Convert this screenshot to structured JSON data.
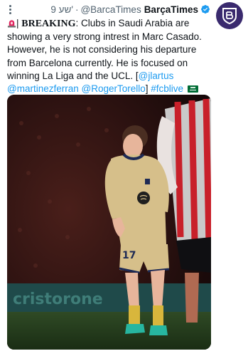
{
  "tweet_header": {
    "display_name": "BarçaTimes",
    "handle": "@BarcaTimes",
    "separator": "·",
    "timestamp": "9 שע'",
    "verified_icon": "verified-badge-icon",
    "more_icon": "more-options-icon"
  },
  "tweet_body": {
    "prefix": "| ",
    "breaking_label": "BREAKING",
    "text": ": Clubs in Saudi Arabia are showing a very strong intrest in Marc Casado. However, he is not considering his departure from Barcelona currently. He is focused on winning La Liga and the UCL. [",
    "mentions": [
      "@jlartus",
      "@martinezferran",
      "@RogerTorello"
    ],
    "closing": "] ",
    "hashtag": "#fcblive",
    "emojis": [
      "siren-icon",
      "saudi-flag-icon"
    ]
  },
  "media": {
    "alt": "Player in gold away kit on pitch at night",
    "shirt_number": "17",
    "board_text": "cristorone"
  },
  "colors": {
    "link": "#1d9bf0",
    "avatar_bg": "#3a2a6e",
    "kit_gold": "#d6bf8a",
    "kit_navy": "#1e2a55"
  }
}
